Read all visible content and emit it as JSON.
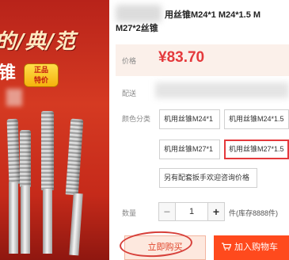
{
  "product": {
    "image": {
      "banner_text": "的/典/范",
      "banner_text_2": "锥",
      "badge_line_1": "正品",
      "badge_line_2": "特价"
    },
    "title_line_1": "用丝锥M24*1 M24*1.5 M",
    "title_line_2": "M27*2丝锥"
  },
  "price": {
    "label": "价格",
    "value": "¥83.70",
    "color": "#e4393c"
  },
  "shipping": {
    "label": "配送"
  },
  "options": {
    "label": "颜色分类",
    "items": [
      "机用丝锥M24*1",
      "机用丝锥M24*1.5",
      "机用丝锥M27*1",
      "机用丝锥M27*1.5",
      "另有配套扳手欢迎咨询价格"
    ],
    "selected_index": 3
  },
  "quantity": {
    "label": "数量",
    "minus": "−",
    "value": "1",
    "plus": "+",
    "stock": "件(库存8888件)"
  },
  "actions": {
    "buy_now": "立即购买",
    "add_to_cart": "加入购物车",
    "accent": "#ff4a1d"
  }
}
